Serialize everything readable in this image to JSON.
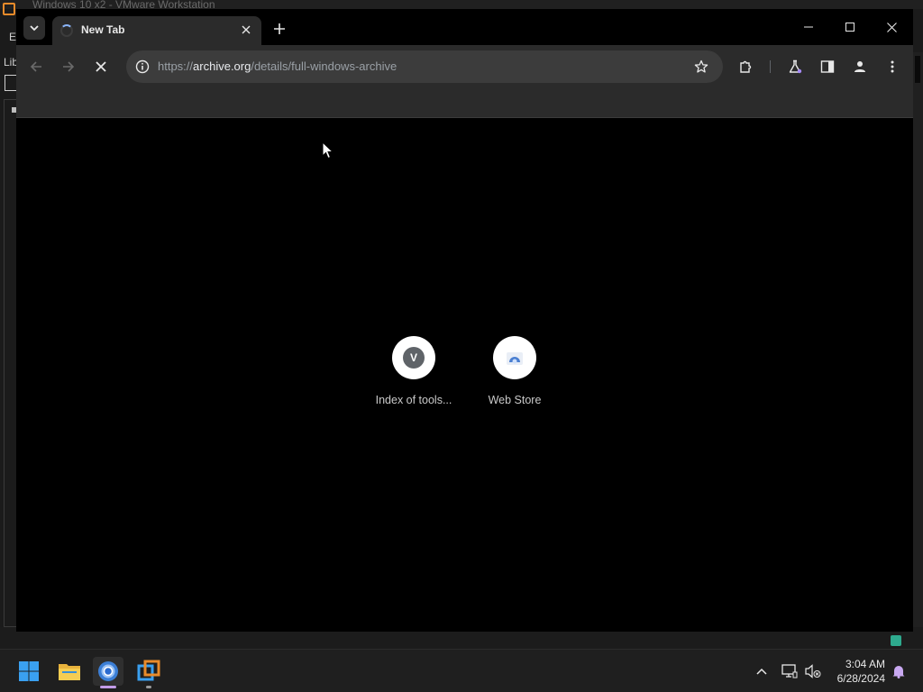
{
  "host_window": {
    "title": "Windows 10 x2 - VMware Workstation",
    "menu_initial": "E",
    "library_label": "Lib"
  },
  "browser": {
    "tab": {
      "title": "New Tab",
      "loading": true
    },
    "omnibox": {
      "url_prefix": "https://",
      "url_host": "archive.org",
      "url_path": "/details/full-windows-archive"
    },
    "shortcuts": [
      {
        "label": "Index of tools...",
        "icon": "v-letter-icon",
        "letter": "V"
      },
      {
        "label": "Web Store",
        "icon": "web-store-icon"
      }
    ]
  },
  "taskbar": {
    "pinned": [
      {
        "name": "start-button",
        "icon": "windows-logo-icon"
      },
      {
        "name": "file-explorer",
        "icon": "folder-icon"
      },
      {
        "name": "chrome",
        "icon": "chrome-icon",
        "active": true
      },
      {
        "name": "vmware-workstation",
        "icon": "vmware-icon"
      }
    ],
    "clock": {
      "time": "3:04 AM",
      "date": "6/28/2024"
    }
  },
  "colors": {
    "accent_blue": "#8ab4f8",
    "toolbar_bg": "#2b2b2b",
    "omnibox_bg": "#3c3c3c",
    "content_bg": "#000000",
    "taskbar_bg": "#1f1f1f",
    "vmware_orange": "#e98b2a",
    "status_teal": "#2eaa8e"
  }
}
